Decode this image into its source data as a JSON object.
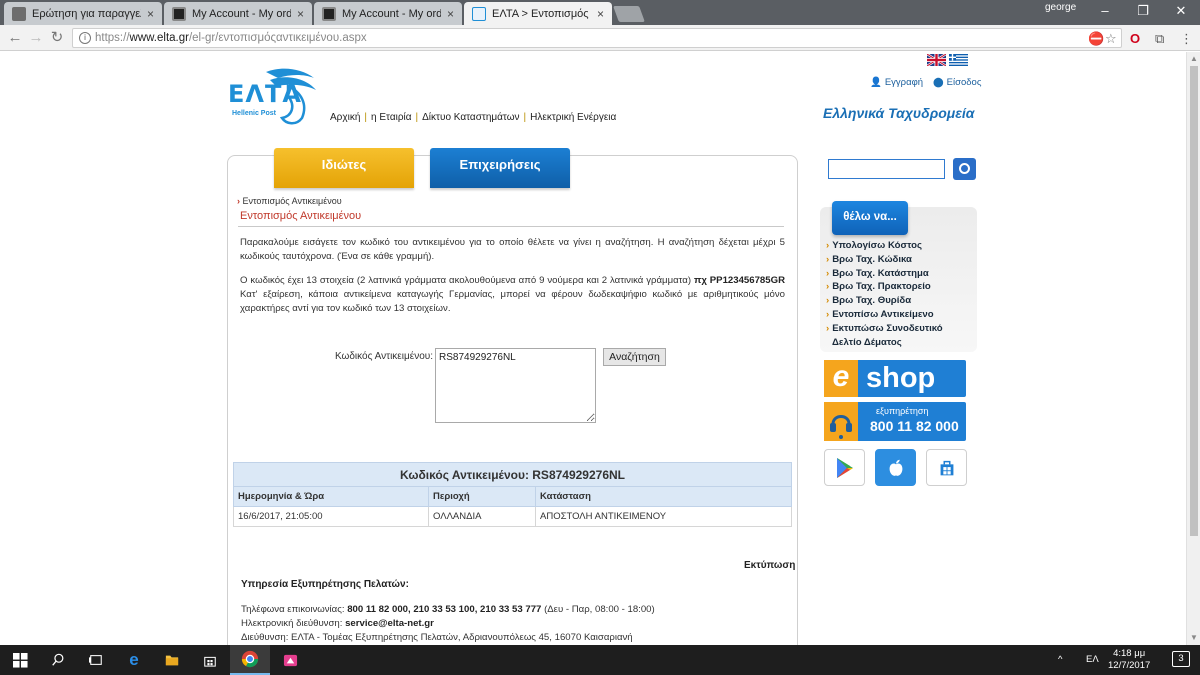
{
  "browser": {
    "tabs": [
      {
        "label": "Ερώτηση για παραγγελ",
        "favicon": "forum-favicon",
        "active": false
      },
      {
        "label": "My Account - My order |",
        "favicon": "account-favicon",
        "active": false
      },
      {
        "label": "My Account - My order |",
        "favicon": "account-favicon",
        "active": false
      },
      {
        "label": "ΕΛΤΑ > Εντοπισμός Αντι",
        "favicon": "elta-favicon",
        "active": true
      }
    ],
    "profile_name": "george",
    "url_scheme": "https://",
    "url_domain": "www.elta.gr",
    "url_path": "/el-gr/εντοπισμόςαντικειμένου.aspx"
  },
  "header": {
    "logo_text": "ΕΛΤΑ",
    "logo_sub": "Hellenic Post",
    "nav": [
      "Αρχική",
      "η Εταιρία",
      "Δίκτυο Καταστημάτων",
      "Ηλεκτρική Ενέργεια"
    ],
    "register": "Εγγραφή",
    "login": "Είσοδος",
    "brand_greek": "Ελληνικά Ταχυδρομεία"
  },
  "tabs": {
    "private": "Ιδιώτες",
    "business": "Επιχειρήσεις"
  },
  "content": {
    "breadcrumb": "Εντοπισμός Αντικειμένου",
    "title": "Εντοπισμός Αντικειμένου",
    "para1": "Παρακαλούμε εισάγετε τον κωδικό του αντικειμένου για το οποίο θέλετε να γίνει η αναζήτηση. Η αναζήτηση δέχεται μέχρι 5 κωδικούς ταυτόχρονα. (Ένα σε κάθε γραμμή).",
    "para2_pre": "Ο κωδικός έχει 13 στοιχεία (2 λατινικά γράμματα ακολουθούμενα από 9 νούμερα και 2 λατινικά γράμματα)",
    "para2_bold": "πχ PP123456785GR",
    "para3": "Κατ' εξαίρεση, κάποια αντικείμενα καταγωγής Γερμανίας, μπορεί να φέρουν δωδεκαψήφιο κωδικό με αριθμητικούς μόνο χαρακτήρες αντί για τον κωδικό των 13 στοιχείων.",
    "field_label": "Κωδικός Αντικειμένου:",
    "field_value": "RS874929276NL",
    "search_button": "Αναζήτηση"
  },
  "results": {
    "heading": "Κωδικός Αντικειμένου: RS874929276NL",
    "columns": [
      "Ημερομηνία & Ώρα",
      "Περιοχή",
      "Κατάσταση"
    ],
    "rows": [
      [
        "16/6/2017, 21:05:00",
        "ΟΛΛΑΝΔΙΑ",
        "ΑΠΟΣΤΟΛΗ ΑΝΤΙΚΕΙΜΕΝΟΥ"
      ]
    ]
  },
  "footer": {
    "print": "Εκτύπωση",
    "title": "Υπηρεσία Εξυπηρέτησης Πελατών:",
    "phone_label": "Τηλέφωνα επικοινωνίας:",
    "phones": "800 11 82 000, 210 33 53 100, 210 33 53 777",
    "hours": "(Δευ - Παρ, 08:00 - 18:00)",
    "email_label": "Ηλεκτρονική διεύθυνση:",
    "email": "service@elta-net.gr",
    "address": "Διεύθυνση: ΕΛΤΑ - Τομέας Εξυπηρέτησης Πελατών, Αδριανουπόλεως 45, 16070 Καισαριανή"
  },
  "sidebar": {
    "thelo_title": "θέλω να...",
    "links": [
      "Υπολογίσω Κόστος",
      "Βρω Ταχ. Κώδικα",
      "Βρω Ταχ. Κατάστημα",
      "Βρω Ταχ. Πρακτορείο",
      "Βρω Ταχ. Θυρίδα",
      "Εντοπίσω Αντικείμενο",
      "Εκτυπώσω Συνοδευτικό",
      "Δελτίο Δέματος"
    ],
    "eshop_e": "e",
    "eshop_text": "shop",
    "support_label": "εξυπηρέτηση",
    "support_phone": "800 11 82 000"
  },
  "taskbar": {
    "lang": "ΕΛ",
    "time": "4:18 μμ",
    "date": "12/7/2017",
    "notifications": "3"
  },
  "colors": {
    "elta_blue": "#1f8fd6",
    "title_red": "#c0392b",
    "tab_yellow": "#f0b216",
    "tab_blue": "#1576c8",
    "eshop_orange": "#f5a51d"
  }
}
